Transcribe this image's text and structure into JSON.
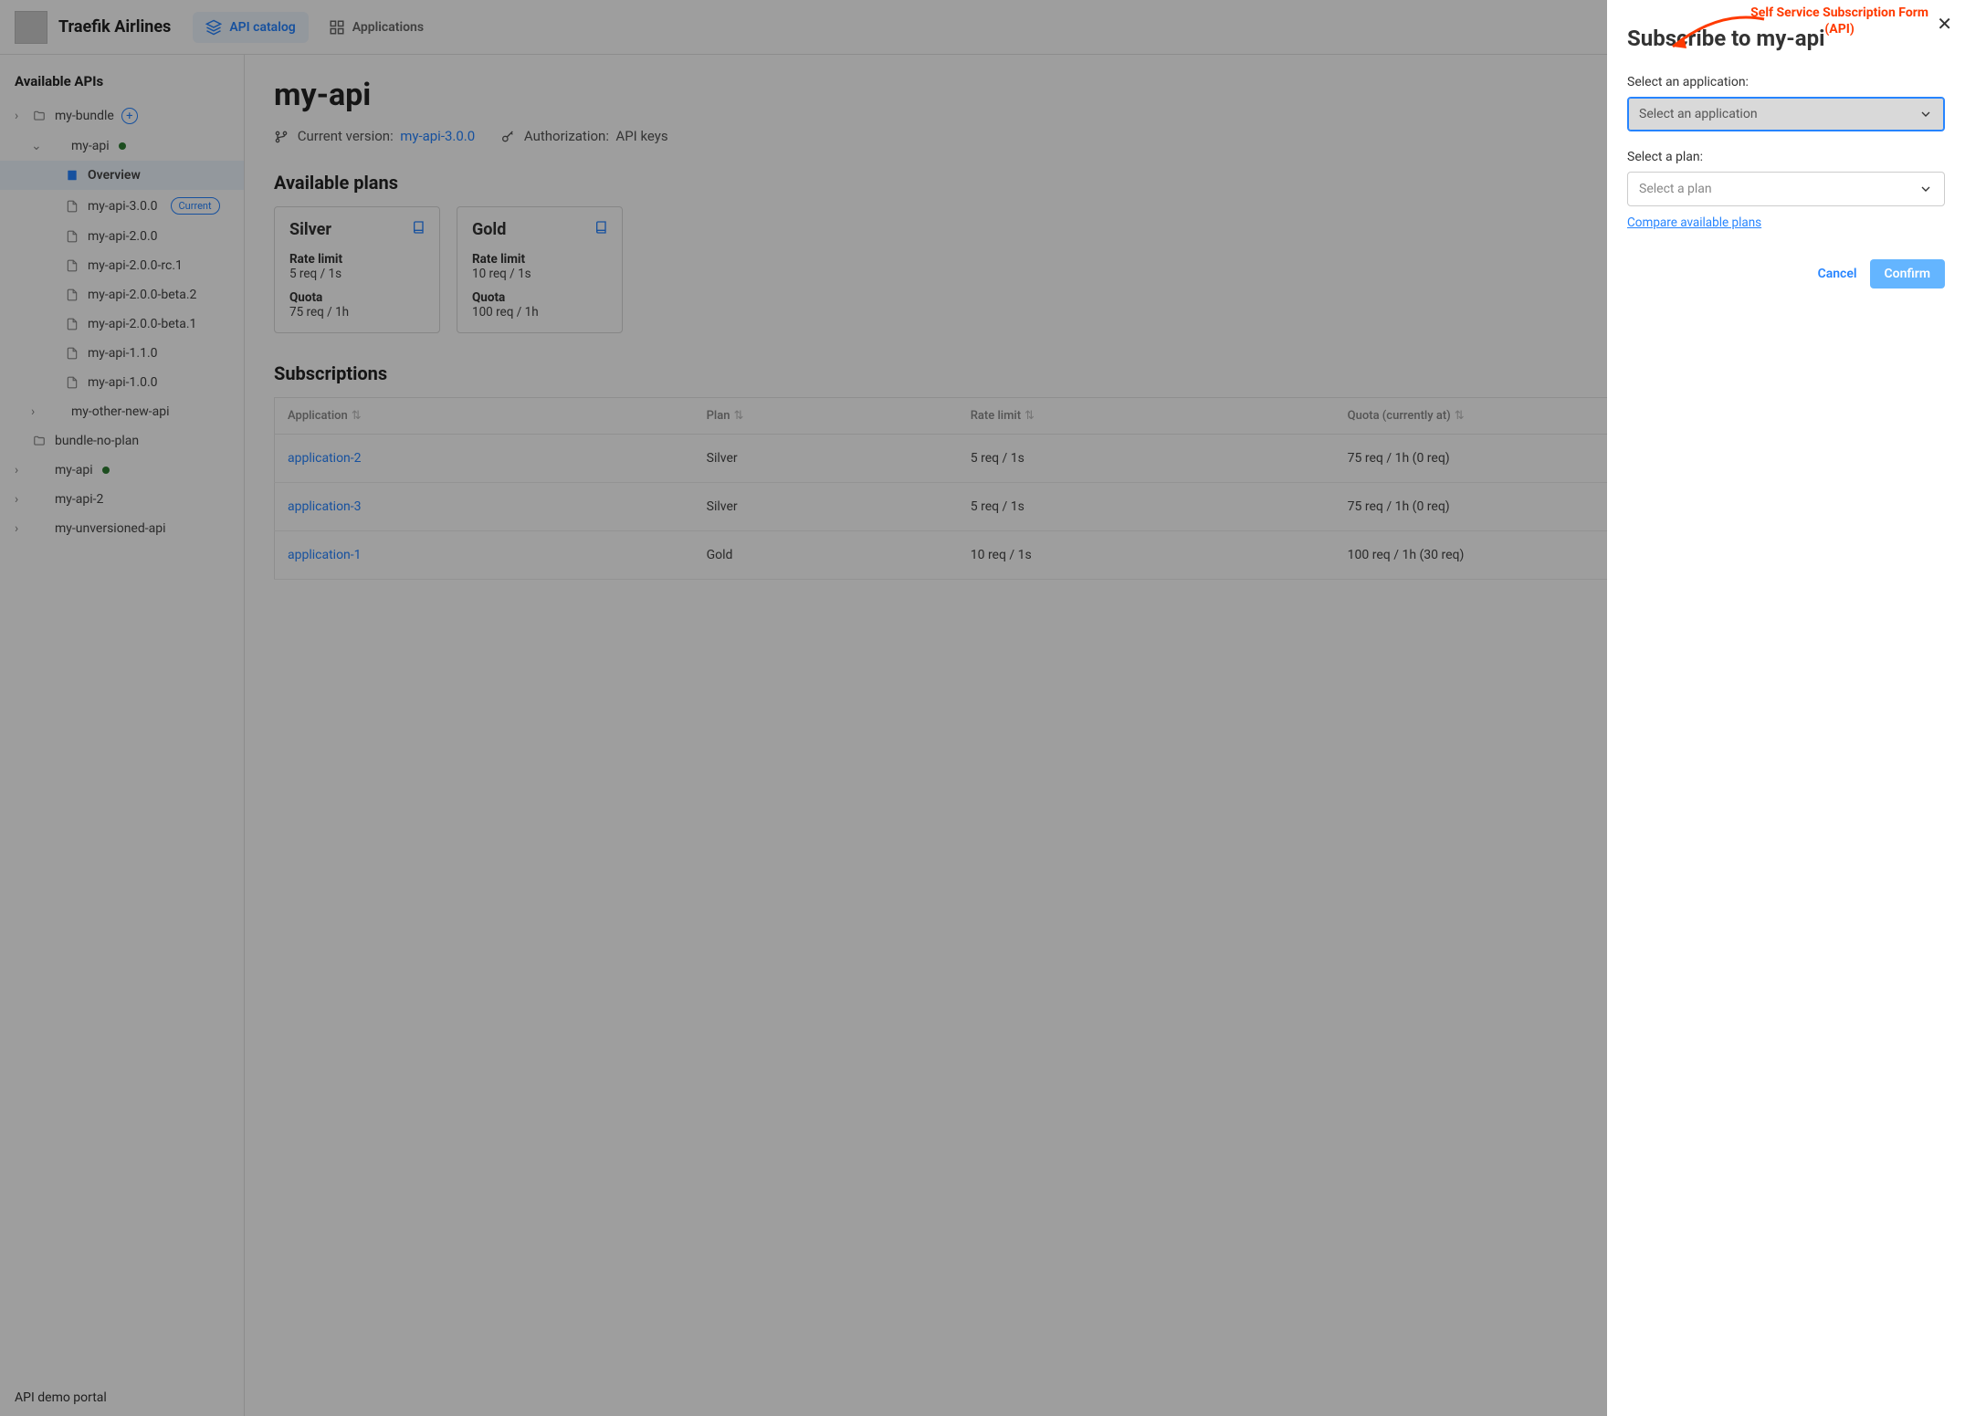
{
  "header": {
    "brand": "Traefik Airlines",
    "nav_catalog": "API catalog",
    "nav_applications": "Applications"
  },
  "sidebar": {
    "title": "Available APIs",
    "footer": "API demo portal",
    "items": [
      {
        "label": "my-bundle",
        "type": "folder",
        "hasAdd": true,
        "depth": 0
      },
      {
        "label": "my-api",
        "type": "api",
        "status": true,
        "depth": 1,
        "expanded": true
      },
      {
        "label": "Overview",
        "type": "overview",
        "depth": 2,
        "active": true
      },
      {
        "label": "my-api-3.0.0",
        "type": "version",
        "depth": 3,
        "current": true
      },
      {
        "label": "my-api-2.0.0",
        "type": "version",
        "depth": 3
      },
      {
        "label": "my-api-2.0.0-rc.1",
        "type": "version",
        "depth": 3
      },
      {
        "label": "my-api-2.0.0-beta.2",
        "type": "version",
        "depth": 3
      },
      {
        "label": "my-api-2.0.0-beta.1",
        "type": "version",
        "depth": 3
      },
      {
        "label": "my-api-1.1.0",
        "type": "version",
        "depth": 3
      },
      {
        "label": "my-api-1.0.0",
        "type": "version",
        "depth": 3
      },
      {
        "label": "my-other-new-api",
        "type": "api",
        "depth": 1,
        "collapsed": true
      },
      {
        "label": "bundle-no-plan",
        "type": "folder-plain",
        "depth": 0
      },
      {
        "label": "my-api",
        "type": "api",
        "status": true,
        "depth": 0,
        "collapsed": true
      },
      {
        "label": "my-api-2",
        "type": "api",
        "depth": 0,
        "collapsed": true
      },
      {
        "label": "my-unversioned-api",
        "type": "api",
        "depth": 0,
        "collapsed": true
      }
    ],
    "current_badge": "Current"
  },
  "content": {
    "title": "my-api",
    "meta": {
      "version_label": "Current version:",
      "version_value": "my-api-3.0.0",
      "auth_label": "Authorization:",
      "auth_value": "API keys"
    },
    "plans_title": "Available plans",
    "plans": [
      {
        "name": "Silver",
        "rate_limit_label": "Rate limit",
        "rate_limit": "5 req / 1s",
        "quota_label": "Quota",
        "quota": "75 req / 1h"
      },
      {
        "name": "Gold",
        "rate_limit_label": "Rate limit",
        "rate_limit": "10 req / 1s",
        "quota_label": "Quota",
        "quota": "100 req / 1h"
      }
    ],
    "subs_title": "Subscriptions",
    "subs_columns": {
      "application": "Application",
      "plan": "Plan",
      "rate_limit": "Rate limit",
      "quota": "Quota (currently at)"
    },
    "subs_rows": [
      {
        "application": "application-2",
        "plan": "Silver",
        "rate_limit": "5 req / 1s",
        "quota": "75 req / 1h (0 req)"
      },
      {
        "application": "application-3",
        "plan": "Silver",
        "rate_limit": "5 req / 1s",
        "quota": "75 req / 1h (0 req)"
      },
      {
        "application": "application-1",
        "plan": "Gold",
        "rate_limit": "10 req / 1s",
        "quota": "100 req / 1h (30 req)"
      }
    ]
  },
  "panel": {
    "title": "Subscribe to my-api",
    "app_label": "Select an application:",
    "app_placeholder": "Select an application",
    "plan_label": "Select a plan:",
    "plan_placeholder": "Select a plan",
    "compare_link": "Compare available plans",
    "cancel": "Cancel",
    "confirm": "Confirm"
  },
  "annotation": {
    "line1": "Self Service Subscription Form",
    "line2": "(API)"
  }
}
